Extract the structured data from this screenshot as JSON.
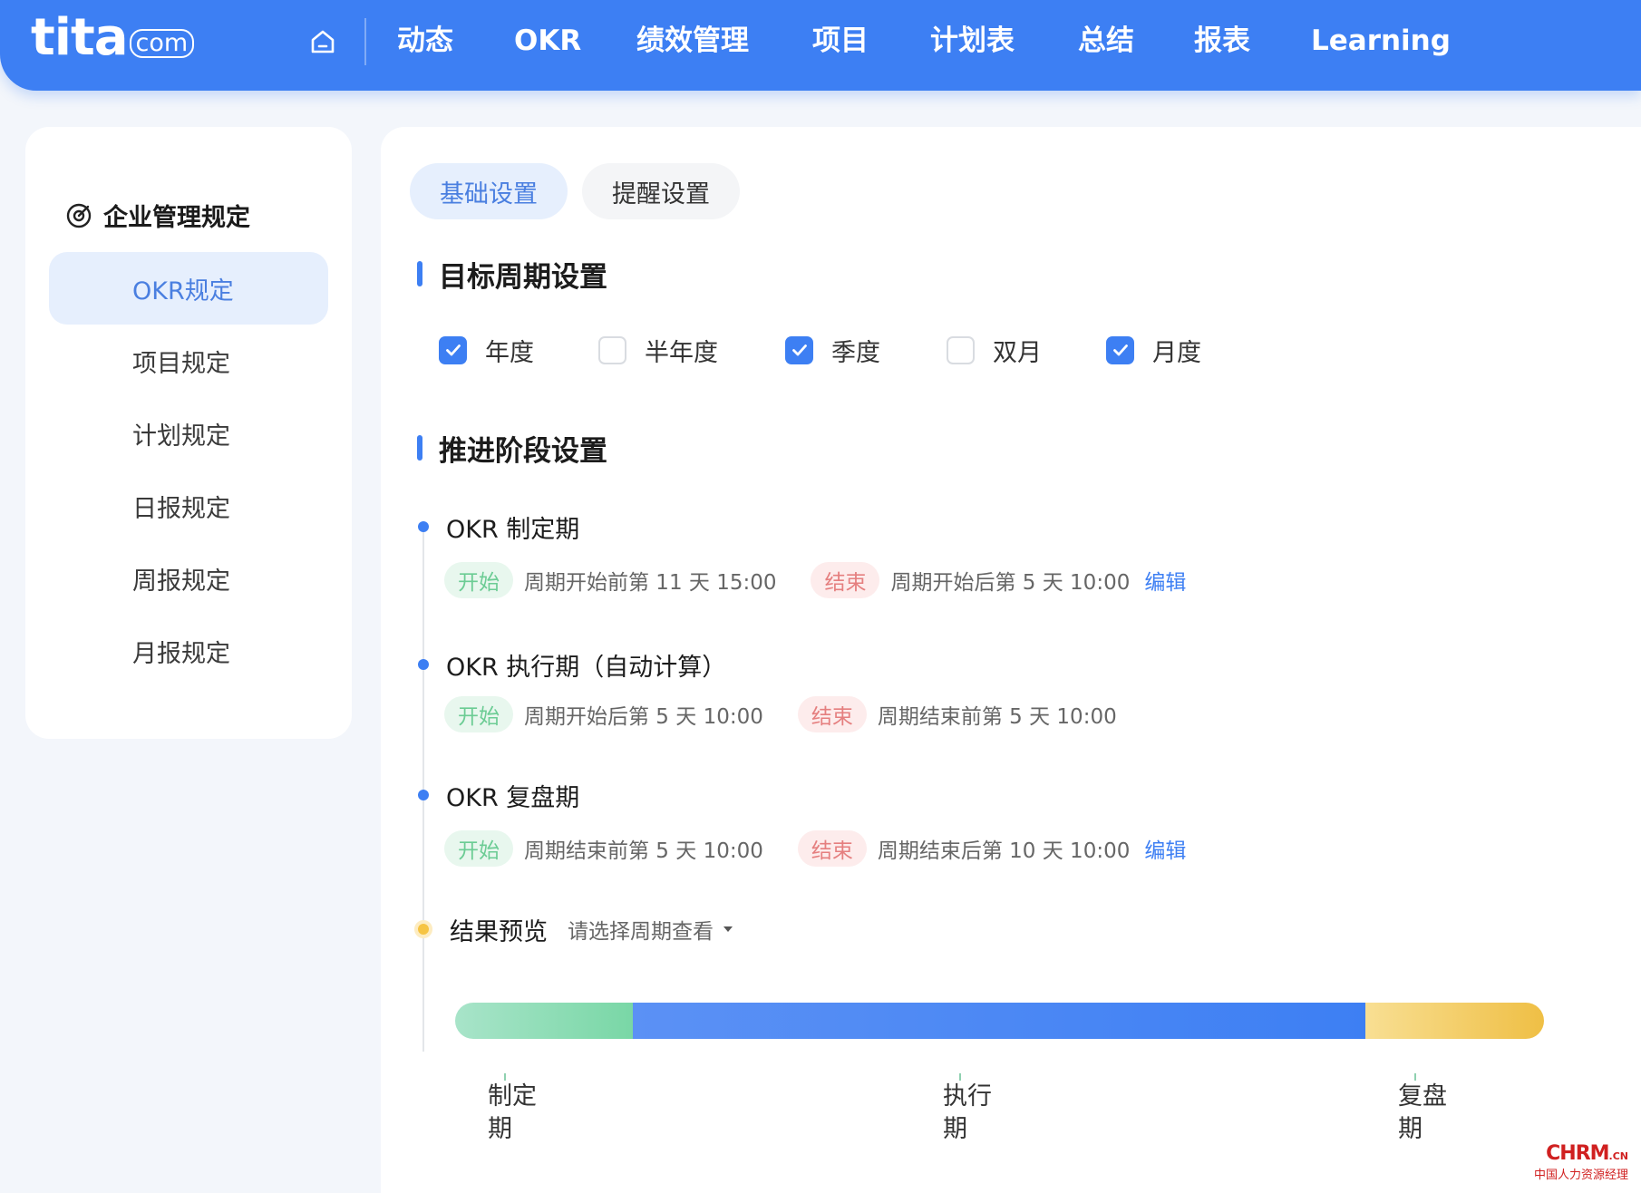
{
  "app": {
    "logo_main": "tita",
    "logo_suffix": "com",
    "brand_color": "#3d7ff3"
  },
  "nav": {
    "home_icon": "home-icon",
    "items": [
      {
        "label": "动态"
      },
      {
        "label": "OKR"
      },
      {
        "label": "绩效管理"
      },
      {
        "label": "项目"
      },
      {
        "label": "计划表"
      },
      {
        "label": "总结"
      },
      {
        "label": "报表"
      },
      {
        "label": "Learning"
      }
    ]
  },
  "sidebar": {
    "title": "企业管理规定",
    "title_icon": "settings-dial-icon",
    "items": [
      {
        "label": "OKR规定",
        "active": true
      },
      {
        "label": "项目规定"
      },
      {
        "label": "计划规定"
      },
      {
        "label": "日报规定"
      },
      {
        "label": "周报规定"
      },
      {
        "label": "月报规定"
      }
    ]
  },
  "tabs": [
    {
      "label": "基础设置",
      "active": true
    },
    {
      "label": "提醒设置"
    }
  ],
  "cycle_section": {
    "title": "目标周期设置",
    "options": [
      {
        "label": "年度",
        "checked": true
      },
      {
        "label": "半年度",
        "checked": false
      },
      {
        "label": "季度",
        "checked": true
      },
      {
        "label": "双月",
        "checked": false
      },
      {
        "label": "月度",
        "checked": true
      }
    ]
  },
  "stage_section": {
    "title": "推进阶段设置",
    "start_tag": "开始",
    "end_tag": "结束",
    "edit_label": "编辑",
    "phases": [
      {
        "title": "OKR 制定期",
        "start": "周期开始前第 11 天 15:00",
        "end": "周期开始后第 5 天 10:00",
        "editable": true
      },
      {
        "title": "OKR 执行期（自动计算）",
        "start": "周期开始后第 5 天 10:00",
        "end": "周期结束前第 5 天 10:00",
        "editable": false
      },
      {
        "title": "OKR 复盘期",
        "start": "周期结束前第 5 天 10:00",
        "end": "周期结束后第 10 天 10:00",
        "editable": true
      }
    ]
  },
  "preview": {
    "label": "结果预览",
    "select_placeholder": "请选择周期查看",
    "segments": [
      {
        "label_line1": "制定",
        "label_line2": "期",
        "fraction": 0.163,
        "color": "#79d7a6"
      },
      {
        "label_line1": "执行",
        "label_line2": "期",
        "fraction": 0.673,
        "color": "#3d7ff3"
      },
      {
        "label_line1": "复盘",
        "label_line2": "期",
        "fraction": 0.164,
        "color": "#efbf45"
      }
    ]
  },
  "watermark": {
    "main": "CHRM",
    "cn": ".CN",
    "sub": "中国人力资源经理"
  }
}
